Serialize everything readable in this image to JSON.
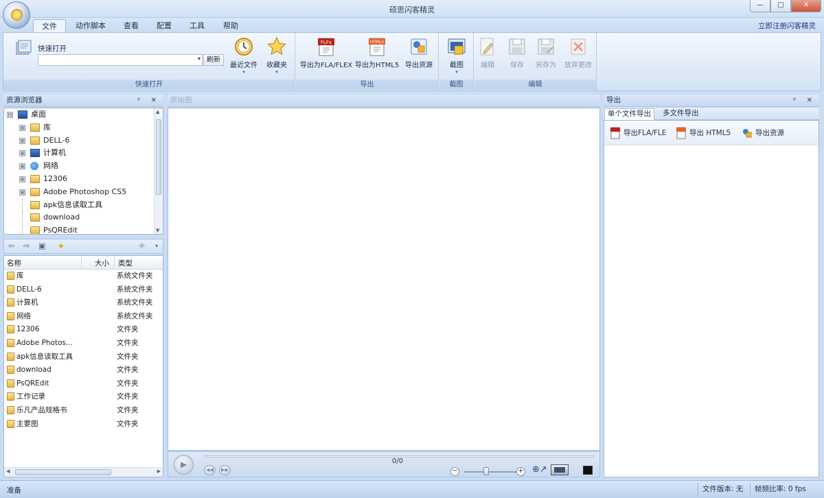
{
  "window": {
    "title": "硕思闪客精灵",
    "minimize": "—",
    "maximize": "□",
    "close": "✕"
  },
  "ribbon": {
    "tabs": [
      "文件",
      "动作脚本",
      "查看",
      "配置",
      "工具",
      "帮助"
    ],
    "active_tab": "文件",
    "register_link": "立即注册闪客精灵",
    "quick_open": {
      "label": "快速打开",
      "input_value": "",
      "dropdown_glyph": "▾",
      "browse_label": "刷新",
      "recent_label": "最近文件",
      "favorites_label": "收藏夹",
      "group_label": "快速打开"
    },
    "export_group": {
      "fla_label": "导出为FLA/FLEX",
      "html5_label": "导出为HTML5",
      "resources_label": "导出资源",
      "group_label": "导出"
    },
    "screenshot_group": {
      "screenshot_label": "截图",
      "group_label": "截图"
    },
    "edit_group": {
      "edit_label": "编辑",
      "save_label": "保存",
      "save_as_label": "另存为",
      "discard_label": "放弃更改",
      "group_label": "编辑"
    }
  },
  "resource_browser": {
    "title": "资源浏览器",
    "pin_glyphs": "ᵖ ✕",
    "tree": [
      {
        "label": "桌面",
        "level": 0,
        "expander": "⊟",
        "icon": "desktop-icon"
      },
      {
        "label": "库",
        "level": 1,
        "expander": "⊞",
        "icon": "library-icon"
      },
      {
        "label": "DELL-6",
        "level": 1,
        "expander": "⊞",
        "icon": "user-folder-icon"
      },
      {
        "label": "计算机",
        "level": 1,
        "expander": "⊞",
        "icon": "computer-icon"
      },
      {
        "label": "网络",
        "level": 1,
        "expander": "⊞",
        "icon": "network-icon"
      },
      {
        "label": "12306",
        "level": 1,
        "expander": "⊞",
        "icon": "folder-icon"
      },
      {
        "label": "Adobe Photoshop CS5",
        "level": 1,
        "expander": "⊞",
        "icon": "folder-icon"
      },
      {
        "label": "apk信息读取工具",
        "level": 1,
        "expander": "",
        "icon": "folder-icon"
      },
      {
        "label": "download",
        "level": 1,
        "expander": "",
        "icon": "folder-icon"
      },
      {
        "label": "PsQREdit",
        "level": 1,
        "expander": "",
        "icon": "folder-icon"
      }
    ],
    "toolbar_glyphs": [
      "⇦",
      "⇨",
      "▣",
      "★",
      "✚",
      "▾"
    ]
  },
  "file_list": {
    "columns": [
      "名称",
      "大小",
      "类型"
    ],
    "rows": [
      {
        "name": "库",
        "type": "系统文件夹"
      },
      {
        "name": "DELL-6",
        "type": "系统文件夹"
      },
      {
        "name": "计算机",
        "type": "系统文件夹"
      },
      {
        "name": "网络",
        "type": "系统文件夹"
      },
      {
        "name": "12306",
        "type": "文件夹"
      },
      {
        "name": "Adobe Photos...",
        "type": "文件夹"
      },
      {
        "name": "apk信息读取工具",
        "type": "文件夹"
      },
      {
        "name": "download",
        "type": "文件夹"
      },
      {
        "name": "PsQREdit",
        "type": "文件夹"
      },
      {
        "name": "工作记录",
        "type": "文件夹"
      },
      {
        "name": "乐凡产品规格书",
        "type": "文件夹"
      },
      {
        "name": "主要图",
        "type": "文件夹"
      }
    ]
  },
  "preview": {
    "title": "原始图",
    "play_glyph": "▶",
    "prev_glyph": "◀◀",
    "next_glyph": "▶▶",
    "frame_counter": "0/0",
    "zoom_level": 0.4,
    "zoom_minus": "−",
    "zoom_plus": "+",
    "fit_glyph": "⊕↗"
  },
  "export_panel": {
    "title": "导出",
    "pin_glyphs": "ᵖ ✕",
    "tabs": [
      "单个文件导出",
      "多文件导出"
    ],
    "active_tab": "单个文件导出",
    "actions": {
      "fla": "导出FLA/FLE",
      "html5": "导出 HTML5",
      "resources": "导出资源"
    }
  },
  "statusbar": {
    "status": "准备",
    "file_version": "文件版本: 无",
    "frame_rate": "帧频比率: 0 fps"
  },
  "colors": {
    "ribbon_bg": "#dde9f7",
    "frame_bg": "#c9dcf2",
    "folder_yellow": "#e6b645",
    "accent_blue": "#2a4a7a"
  }
}
